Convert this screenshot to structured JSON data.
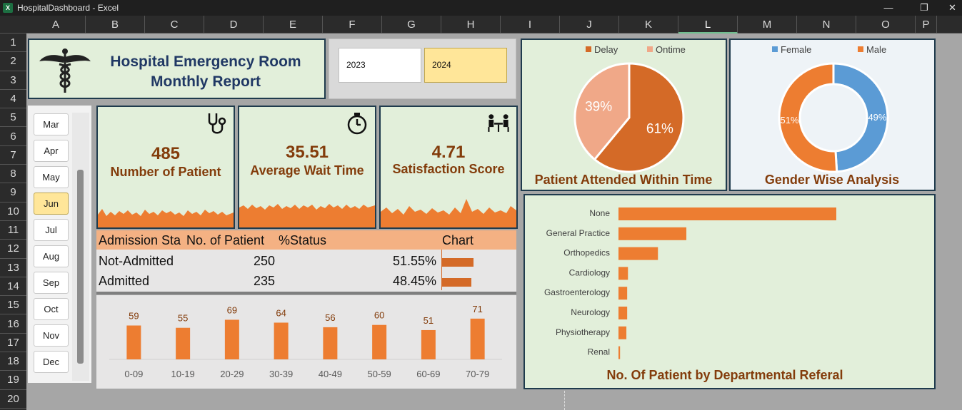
{
  "window": {
    "title": "HospitalDashboard - Excel",
    "app_icon": "X",
    "minimize": "—",
    "restore": "❐",
    "close": "✕"
  },
  "columns": [
    "A",
    "B",
    "C",
    "D",
    "E",
    "F",
    "G",
    "H",
    "I",
    "J",
    "K",
    "L",
    "M",
    "N",
    "O",
    "P"
  ],
  "rows": [
    "1",
    "2",
    "3",
    "4",
    "5",
    "6",
    "7",
    "8",
    "9",
    "10",
    "11",
    "12",
    "13",
    "14",
    "15",
    "16",
    "17",
    "18",
    "19",
    "20"
  ],
  "header": {
    "title_line1": "Hospital Emergency Room",
    "title_line2": "Monthly Report",
    "logo_icon": "caduceus-icon"
  },
  "years": [
    {
      "label": "2023",
      "selected": false
    },
    {
      "label": "2024",
      "selected": true
    }
  ],
  "months": [
    {
      "label": "Mar",
      "selected": false
    },
    {
      "label": "Apr",
      "selected": false
    },
    {
      "label": "May",
      "selected": false
    },
    {
      "label": "Jun",
      "selected": true
    },
    {
      "label": "Jul",
      "selected": false
    },
    {
      "label": "Aug",
      "selected": false
    },
    {
      "label": "Sep",
      "selected": false
    },
    {
      "label": "Oct",
      "selected": false
    },
    {
      "label": "Nov",
      "selected": false
    },
    {
      "label": "Dec",
      "selected": false
    }
  ],
  "kpis": [
    {
      "value": "485",
      "label": "Number of Patient",
      "icon": "stethoscope-icon"
    },
    {
      "value": "35.51",
      "label": "Average Wait Time",
      "icon": "stopwatch-icon"
    },
    {
      "value": "4.71",
      "label": "Satisfaction Score",
      "icon": "consultation-icon"
    }
  ],
  "admission_table": {
    "headers": [
      "Admission Sta",
      "No. of Patient",
      "%Status",
      "Chart"
    ],
    "rows": [
      {
        "status": "Not-Admitted",
        "count": "250",
        "pct": "51.55%",
        "pct_value": 51.55
      },
      {
        "status": "Admitted",
        "count": "235",
        "pct": "48.45%",
        "pct_value": 48.45
      }
    ]
  },
  "colors": {
    "accent": "#ed7d31",
    "dark_orange": "#d46a27",
    "light_orange": "#f0a888",
    "female_blue": "#5b9bd5",
    "panel_green": "#e2efda",
    "title_brown": "#833c0b",
    "title_navy": "#203864"
  },
  "chart_data": [
    {
      "type": "bar",
      "title": "",
      "categories": [
        "0-09",
        "10-19",
        "20-29",
        "30-39",
        "40-49",
        "50-59",
        "60-69",
        "70-79"
      ],
      "values": [
        59,
        55,
        69,
        64,
        56,
        60,
        51,
        71
      ],
      "ylim": [
        0,
        80
      ]
    },
    {
      "type": "pie",
      "title": "Patient Attended Within Time",
      "legend": [
        "Delay",
        "Ontime"
      ],
      "legend_position": "top",
      "slices": [
        {
          "name": "Delay",
          "value": 61,
          "label": "61%"
        },
        {
          "name": "Ontime",
          "value": 39,
          "label": "39%"
        }
      ]
    },
    {
      "type": "pie",
      "subtype": "donut",
      "title": "Gender Wise Analysis",
      "legend": [
        "Female",
        "Male"
      ],
      "legend_position": "top",
      "slices": [
        {
          "name": "Female",
          "value": 49,
          "label": "49%"
        },
        {
          "name": "Male",
          "value": 51,
          "label": "51%"
        }
      ]
    },
    {
      "type": "bar",
      "orientation": "horizontal",
      "title": "No. Of Patient by Departmental Referal",
      "categories": [
        "None",
        "General Practice",
        "Orthopedics",
        "Cardiology",
        "Gastroenterology",
        "Neurology",
        "Physiotherapy",
        "Renal"
      ],
      "values": [
        276,
        86,
        50,
        12,
        11,
        11,
        10,
        2
      ]
    }
  ]
}
